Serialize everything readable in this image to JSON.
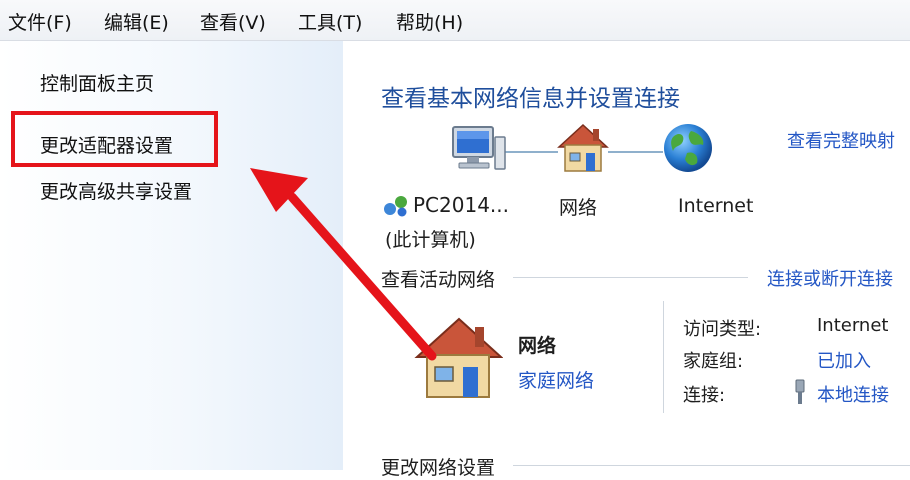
{
  "menu": {
    "file": "文件(F)",
    "edit": "编辑(E)",
    "view": "查看(V)",
    "tools": "工具(T)",
    "help": "帮助(H)"
  },
  "sidebar": {
    "home": "控制面板主页",
    "adapter": "更改适配器设置",
    "sharing": "更改高级共享设置"
  },
  "main": {
    "title": "查看基本网络信息并设置连接",
    "full_map_link": "查看完整映射",
    "map": {
      "pc_name": "PC2014...",
      "pc_sub": "(此计算机)",
      "network": "网络",
      "internet": "Internet"
    },
    "active": {
      "header": "查看活动网络",
      "connect_link": "连接或断开连接",
      "network_name": "网络",
      "network_type": "家庭网络",
      "access_label": "访问类型:",
      "access_value": "Internet",
      "homegroup_label": "家庭组:",
      "homegroup_value": "已加入",
      "connection_label": "连接:",
      "connection_value": "本地连接"
    },
    "change_header": "更改网络设置"
  },
  "colors": {
    "highlight_box": "#e5141a",
    "arrow": "#e5141a",
    "link": "#2457c5",
    "title": "#1f4e9c"
  },
  "icons": {
    "computer": "computer-icon",
    "house": "house-icon",
    "globe": "globe-icon",
    "network_badge": "network-badge-icon",
    "ethernet": "ethernet-icon"
  }
}
